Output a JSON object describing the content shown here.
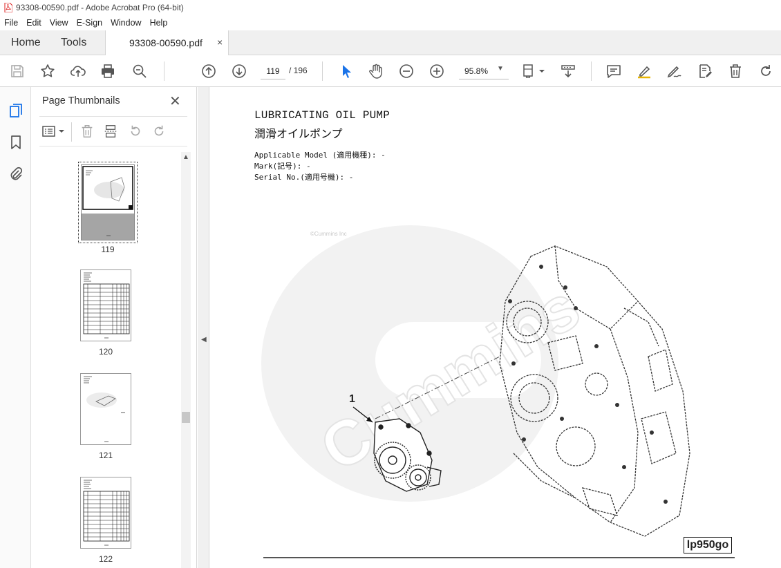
{
  "window": {
    "title": "93308-00590.pdf - Adobe Acrobat Pro (64-bit)"
  },
  "menu": [
    "File",
    "Edit",
    "View",
    "E-Sign",
    "Window",
    "Help"
  ],
  "tabs": {
    "home": "Home",
    "tools": "Tools",
    "document": "93308-00590.pdf",
    "close": "×"
  },
  "toolbar": {
    "page_current": "119",
    "page_total": "/ 196",
    "zoom": "95.8%"
  },
  "panel": {
    "title": "Page Thumbnails",
    "close": "✕",
    "thumbnails": [
      {
        "label": "119"
      },
      {
        "label": "120"
      },
      {
        "label": "121"
      },
      {
        "label": "122"
      }
    ]
  },
  "document": {
    "title_en": "LUBRICATING OIL PUMP",
    "title_ja": "潤滑オイルポンプ",
    "meta": [
      "Applicable Model (適用機種): -",
      "Mark(記号): -",
      "Serial No.(適用号機): -"
    ],
    "callout": "1",
    "figure_ref": "lp950go",
    "watermark": "Cummins",
    "watermark_small": "©Cummins Inc"
  }
}
